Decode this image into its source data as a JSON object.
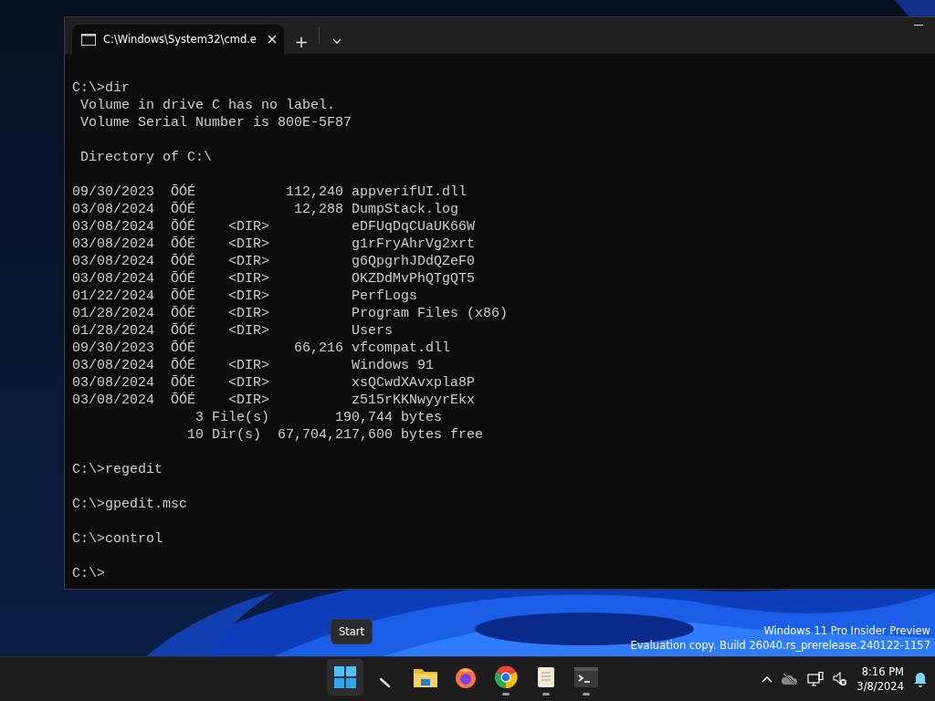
{
  "window": {
    "tabs": [
      {
        "title": "C:\\Windows\\System32\\cmd.e",
        "selected": true
      }
    ],
    "new_tab": "+"
  },
  "console": {
    "blocks": [
      [
        "C:\\>dir",
        " Volume in drive C has no label.",
        " Volume Serial Number is 800E-5F87"
      ],
      [
        " Directory of C:\\"
      ],
      [
        "09/30/2023  ÕÓÉ           112,240 appverifUI.dll",
        "03/08/2024  ÕÓÉ            12,288 DumpStack.log",
        "03/08/2024  ÕÓÉ    <DIR>          eDFUqDqCUaUK66W",
        "03/08/2024  ÕÓÉ    <DIR>          g1rFryAhrVg2xrt",
        "03/08/2024  ÕÓÉ    <DIR>          g6QpgrhJDdQZeF0",
        "03/08/2024  ÕÓÉ    <DIR>          OKZDdMvPhQTgQT5",
        "01/22/2024  ÕÓÉ    <DIR>          PerfLogs",
        "01/28/2024  ÕÓÉ    <DIR>          Program Files (x86)",
        "01/28/2024  ÕÓÉ    <DIR>          Users",
        "09/30/2023  ÕÓÉ            66,216 vfcompat.dll",
        "03/08/2024  ÕÓÉ    <DIR>          Windows 91",
        "03/08/2024  ÕÓÉ    <DIR>          xsQCwdXAvxpla8P",
        "03/08/2024  ÕÓÉ    <DIR>          z515rKKNwyyrEkx",
        "               3 File(s)        190,744 bytes",
        "              10 Dir(s)  67,704,217,600 bytes free"
      ],
      [
        "C:\\>regedit"
      ],
      [
        "C:\\>gpedit.msc"
      ],
      [
        "C:\\>control"
      ],
      [
        "C:\\>"
      ]
    ]
  },
  "tooltip": "Start",
  "watermark": [
    "Windows 11 Pro Insider Preview",
    "Evaluation copy. Build 26040.rs_prerelease.240122-1157"
  ],
  "taskbar": {
    "apps": [
      {
        "kind": "start",
        "hovered": true,
        "running": false
      },
      {
        "kind": "pen",
        "hovered": false,
        "running": false
      },
      {
        "kind": "folder",
        "hovered": false,
        "running": false
      },
      {
        "kind": "firefox",
        "hovered": false,
        "running": false
      },
      {
        "kind": "chrome",
        "hovered": false,
        "running": true
      },
      {
        "kind": "notepad",
        "hovered": false,
        "running": true
      },
      {
        "kind": "terminal",
        "hovered": false,
        "running": true
      }
    ],
    "clock": {
      "time": "8:16 PM",
      "date": "3/8/2024"
    }
  }
}
